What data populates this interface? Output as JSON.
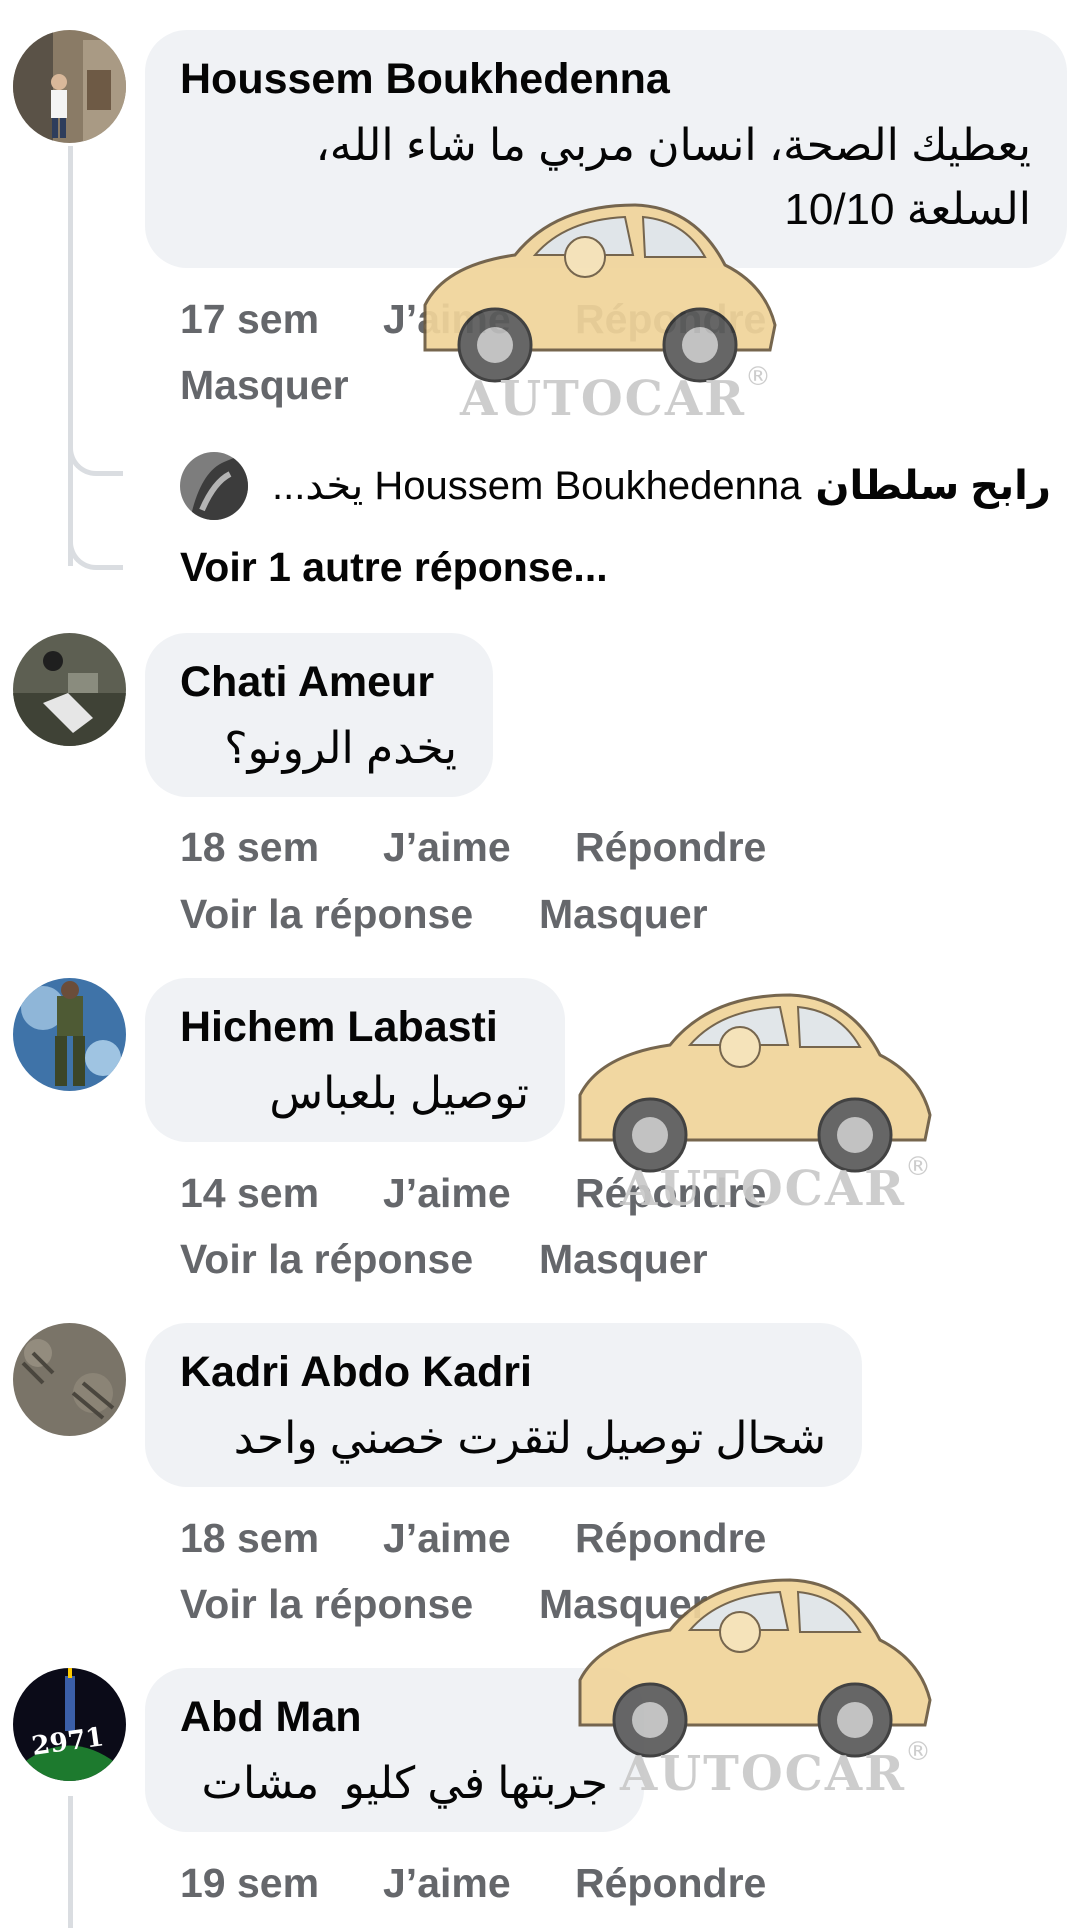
{
  "comments": [
    {
      "author": "Houssem Boukhedenna",
      "text": "يعطيك الصحة، انسان مربي ما شاء الله،\nالسلعة 10/10",
      "actions": {
        "time": "17 sem",
        "like": "J’aime",
        "reply": "Répondre",
        "hide": "Masquer"
      },
      "reply_preview": {
        "name": "رابح سلطان",
        "text": "Houssem Boukhedenna يخد..."
      },
      "more_replies": "Voir 1 autre réponse..."
    },
    {
      "author": "Chati Ameur",
      "text": "يخدم الرونو؟",
      "actions": {
        "time": "18 sem",
        "like": "J’aime",
        "reply": "Répondre",
        "see_reply": "Voir la réponse",
        "hide": "Masquer"
      }
    },
    {
      "author": "Hichem Labasti",
      "text": "توصيل بلعباس",
      "actions": {
        "time": "14 sem",
        "like": "J’aime",
        "reply": "Répondre",
        "see_reply": "Voir la réponse",
        "hide": "Masquer"
      }
    },
    {
      "author": "Kadri Abdo Kadri",
      "text": "شحال توصيل لتقرت خصني واحد",
      "actions": {
        "time": "18 sem",
        "like": "J’aime",
        "reply": "Répondre",
        "see_reply": "Voir la réponse",
        "hide": "Masquer"
      }
    },
    {
      "author": "Abd Man",
      "text": "جربتها في كليو  مشات",
      "avatar_text": "2971",
      "actions": {
        "time": "19 sem",
        "like": "J’aime",
        "reply": "Répondre"
      }
    }
  ],
  "watermark": {
    "label": "AUTOCAR",
    "mark": "®"
  },
  "colors": {
    "bubble": "#f0f2f5",
    "action_text": "#65676b",
    "text": "#050505",
    "thread_line": "#dadde1",
    "watermark_car": "#f0d49a"
  }
}
